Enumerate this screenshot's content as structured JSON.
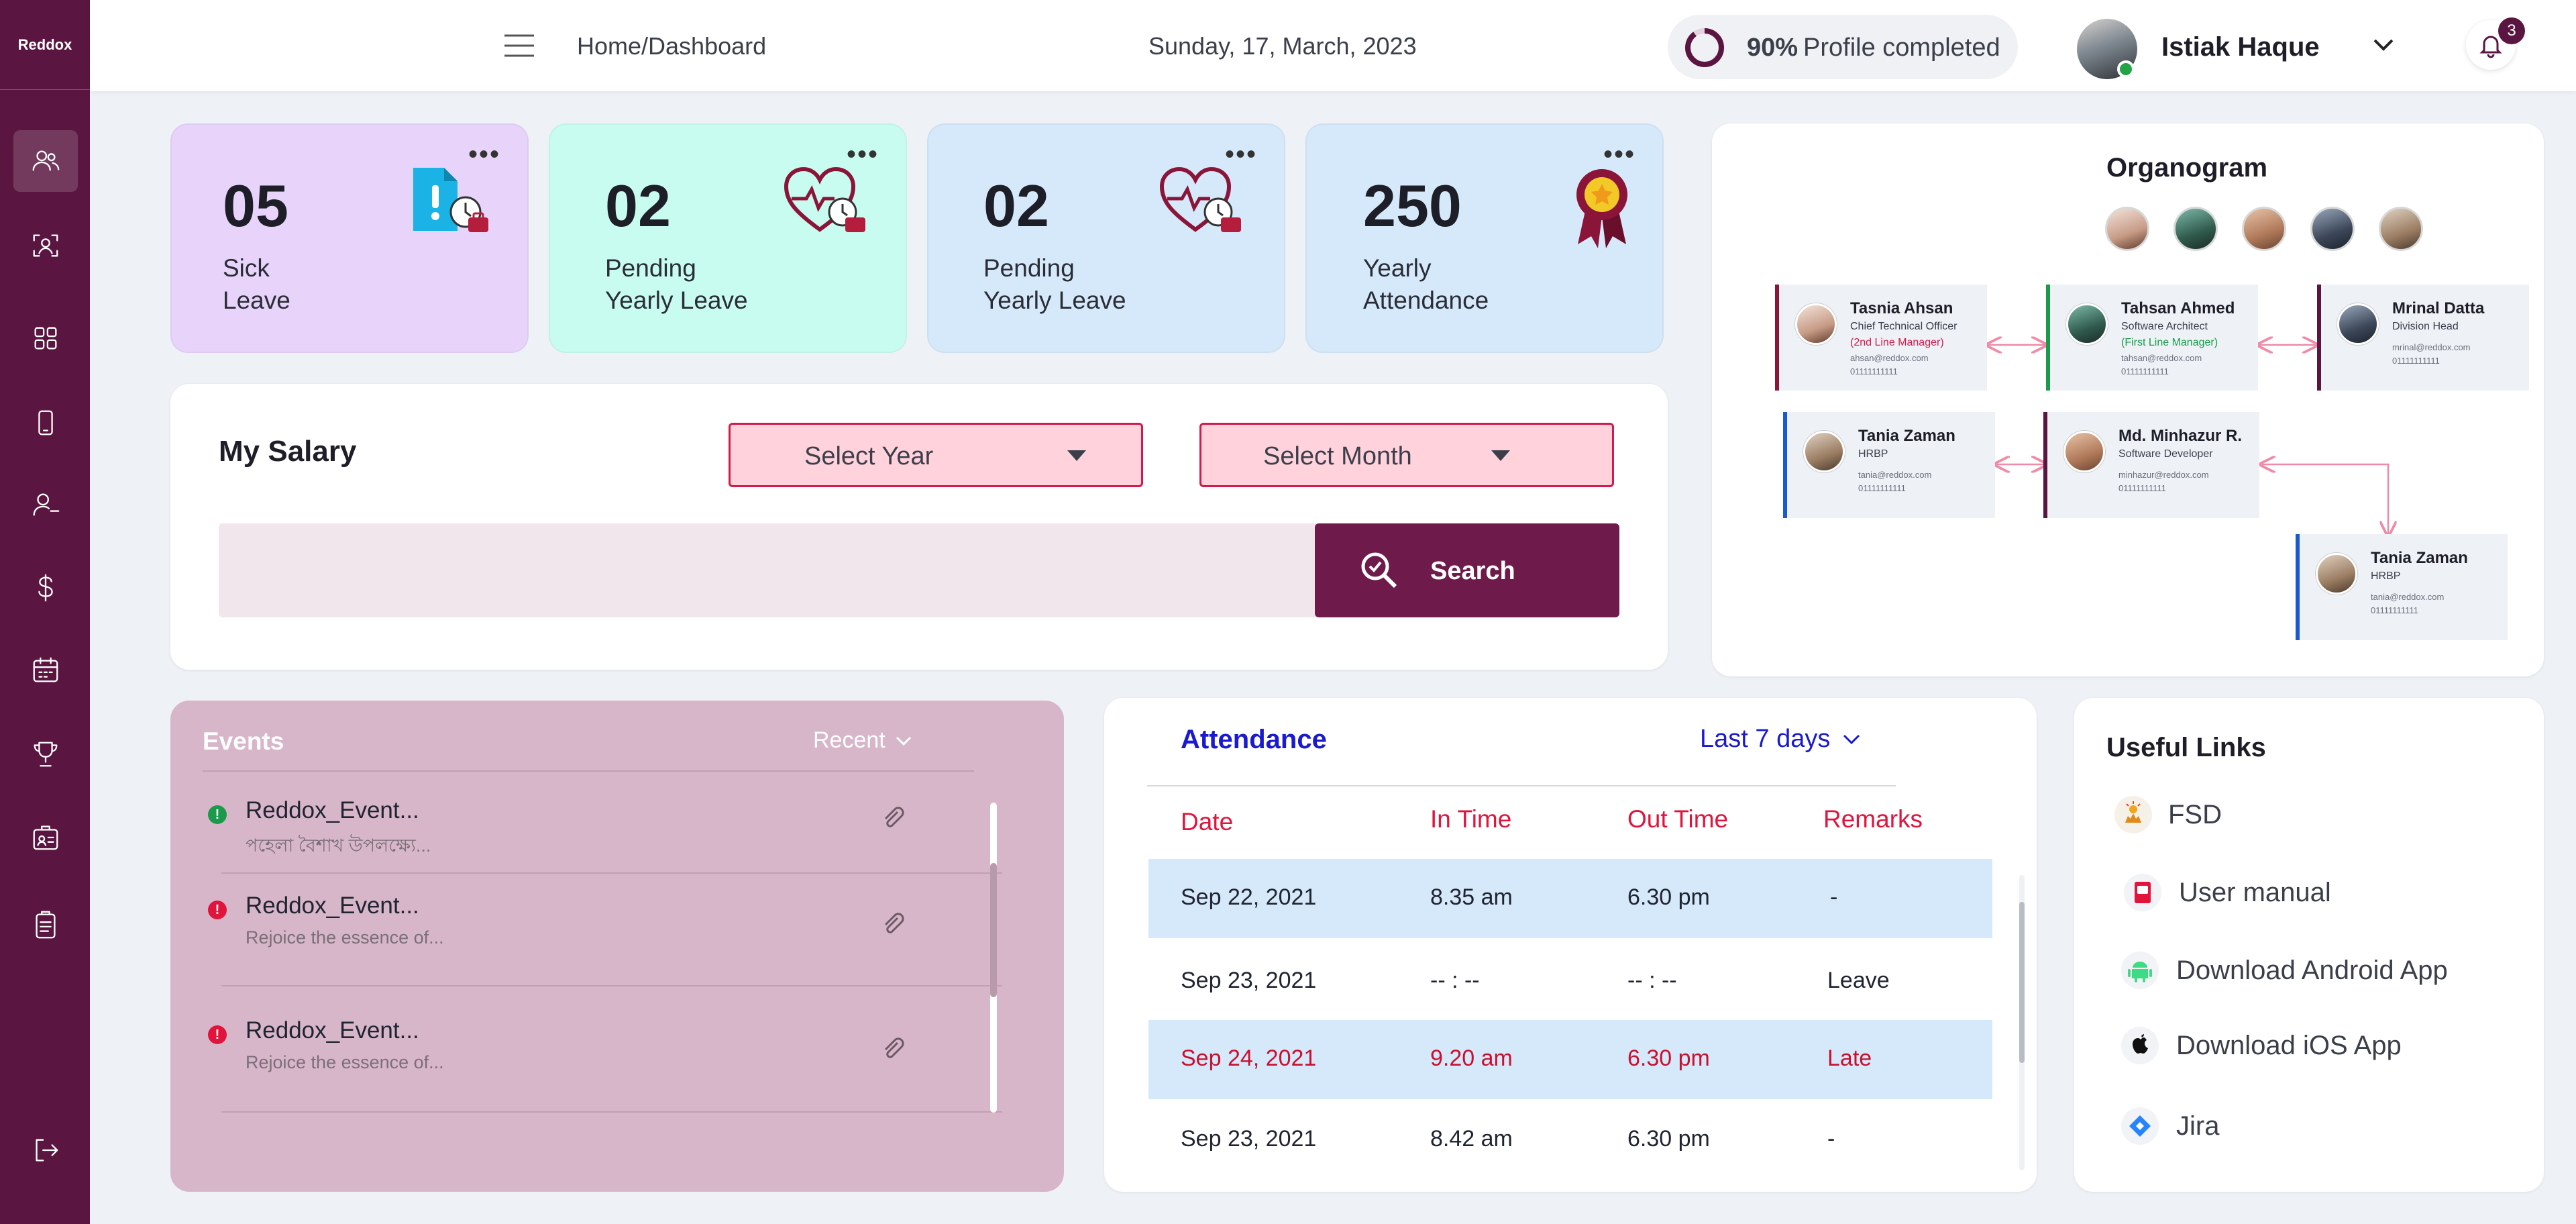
{
  "sidebar": {
    "logo": "Reddox",
    "icons": [
      "users-icon",
      "face-scan-icon",
      "apps-grid-icon",
      "mobile-icon",
      "user-minus-icon",
      "dollar-icon",
      "calendar-icon",
      "trophy-icon",
      "id-badge-icon",
      "clipboard-icon",
      "logout-icon"
    ],
    "active_index": 0
  },
  "header": {
    "breadcrumb": "Home/Dashboard",
    "date": "Sunday, 17, March, 2023",
    "profile_percent": "90%",
    "profile_label": "Profile completed",
    "profile_progress": 0.9,
    "user_name": "Istiak Haque",
    "notification_count": "3"
  },
  "stats": [
    {
      "number": "05",
      "line1": "Sick",
      "line2": "Leave",
      "icon": "sick-leave-icon",
      "bg": "#e8d4fb"
    },
    {
      "number": "02",
      "line1": "Pending",
      "line2": "Yearly Leave",
      "icon": "heart-leave-icon",
      "bg": "#c9fcf0"
    },
    {
      "number": "02",
      "line1": "Pending",
      "line2": "Yearly Leave",
      "icon": "heart-leave-icon",
      "bg": "#d6e9fb"
    },
    {
      "number": "250",
      "line1": "Yearly",
      "line2": "Attendance",
      "icon": "award-ribbon-icon",
      "bg": "#d6e9fb"
    }
  ],
  "salary": {
    "title": "My Salary",
    "year_placeholder": "Select Year",
    "month_placeholder": "Select Month",
    "search_label": "Search"
  },
  "organogram": {
    "title": "Organogram",
    "people": [
      {
        "name": "Tasnia Ahsan",
        "role": "Chief Technical Officer",
        "manager": "(2nd Line Manager)",
        "email": "ahsan@reddox.com",
        "phone": "01111111111",
        "accent": "#8a1538",
        "mgr_color": "#d11b4b"
      },
      {
        "name": "Tahsan Ahmed",
        "role": "Software Architect",
        "manager": "(First Line Manager)",
        "email": "tahsan@reddox.com",
        "phone": "01111111111",
        "accent": "#1a9a4a",
        "mgr_color": "#1a9a4a"
      },
      {
        "name": "Mrinal Datta",
        "role": "Division Head",
        "manager": "",
        "email": "mrinal@reddox.com",
        "phone": "01111111111",
        "accent": "#5a1540",
        "mgr_color": "#5a1540"
      },
      {
        "name": "Tania Zaman",
        "role": "HRBP",
        "manager": "",
        "email": "tania@reddox.com",
        "phone": "01111111111",
        "accent": "#1a5ad1",
        "mgr_color": "#1a5ad1"
      },
      {
        "name": "Md. Minhazur R.",
        "role": "Software Developer",
        "manager": "",
        "email": "minhazur@reddox.com",
        "phone": "01111111111",
        "accent": "#5a1540",
        "mgr_color": "#5a1540"
      },
      {
        "name": "Tania Zaman",
        "role": "HRBP",
        "manager": "",
        "email": "tania@reddox.com",
        "phone": "01111111111",
        "accent": "#1a5ad1",
        "mgr_color": "#1a5ad1"
      }
    ]
  },
  "events": {
    "title": "Events",
    "filter": "Recent",
    "items": [
      {
        "name": "Reddox_Event...",
        "desc": "পহেলা বৈশাখ উপলক্ষ্যে...",
        "status": "green"
      },
      {
        "name": "Reddox_Event...",
        "desc": "Rejoice the essence of...",
        "status": "red"
      },
      {
        "name": "Reddox_Event...",
        "desc": "Rejoice the essence of...",
        "status": "red"
      }
    ]
  },
  "attendance": {
    "title": "Attendance",
    "filter": "Last 7 days",
    "columns": [
      "Date",
      "In Time",
      "Out Time",
      "Remarks"
    ],
    "rows": [
      {
        "date": "Sep 22, 2021",
        "in": "8.35 am",
        "out": "6.30 pm",
        "remarks": "-",
        "highlight": true,
        "late": false
      },
      {
        "date": "Sep 23, 2021",
        "in": "-- : --",
        "out": "-- : --",
        "remarks": "Leave",
        "highlight": false,
        "late": false
      },
      {
        "date": "Sep 24, 2021",
        "in": "9.20 am",
        "out": "6.30 pm",
        "remarks": "Late",
        "highlight": true,
        "late": true
      },
      {
        "date": "Sep 23, 2021",
        "in": "8.42 am",
        "out": "6.30 pm",
        "remarks": "-",
        "highlight": false,
        "late": false
      }
    ]
  },
  "links": {
    "title": "Useful Links",
    "items": [
      {
        "label": "FSD",
        "icon": "sun-logo-icon"
      },
      {
        "label": "User manual",
        "icon": "manual-book-icon"
      },
      {
        "label": "Download Android App",
        "icon": "android-icon"
      },
      {
        "label": "Download iOS App",
        "icon": "apple-icon"
      },
      {
        "label": "Jira",
        "icon": "jira-icon"
      }
    ]
  },
  "colors": {
    "brand": "#5a1540",
    "accent_red": "#e0143c",
    "link_blue": "#1a1ad1"
  }
}
